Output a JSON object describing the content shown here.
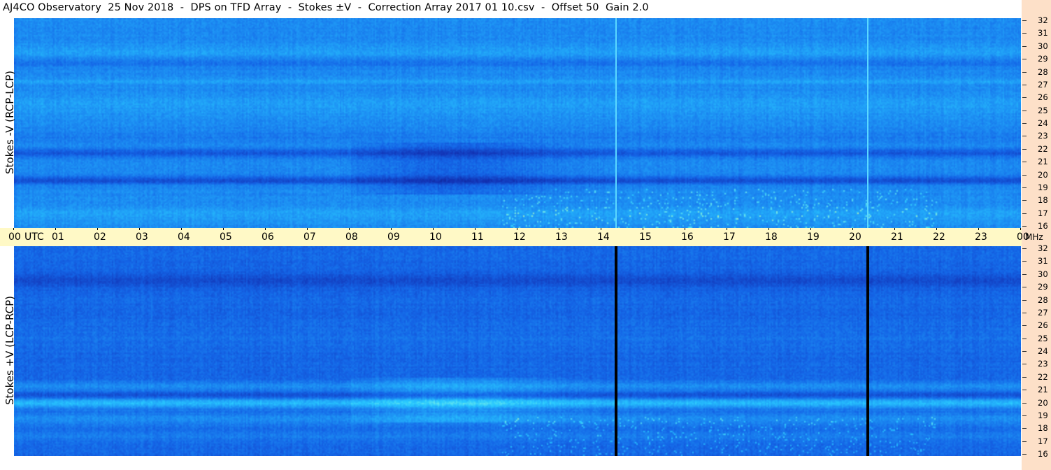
{
  "header": {
    "title": "AJ4CO Observatory  25 Nov 2018  -  DPS on TFD Array  -  Stokes ±V  -  Correction Array 2017 01 10.csv  -  Offset 50  Gain 2.0"
  },
  "chart_data": {
    "type": "heatmap",
    "title": "AJ4CO Observatory  25 Nov 2018  -  DPS on TFD Array  -  Stokes ±V  -  Correction Array 2017 01 10.csv  -  Offset 50  Gain 2.0",
    "x_axis": {
      "unit_label": "UTC",
      "range_hours": [
        0,
        24
      ],
      "tick_labels": [
        "00",
        "01",
        "02",
        "03",
        "04",
        "05",
        "06",
        "07",
        "08",
        "09",
        "10",
        "11",
        "12",
        "13",
        "14",
        "15",
        "16",
        "17",
        "18",
        "19",
        "20",
        "21",
        "22",
        "23",
        "00"
      ]
    },
    "y_axis": {
      "unit_label": "MHz",
      "range_mhz": [
        16,
        32
      ],
      "tick_labels": [
        "32",
        "31",
        "30",
        "29",
        "28",
        "27",
        "26",
        "25",
        "24",
        "23",
        "22",
        "21",
        "20",
        "19",
        "18",
        "17",
        "16"
      ]
    },
    "panels": [
      {
        "name": "top",
        "ylabel": "Stokes -V (RCP-LCP)",
        "palette": "cyan-blue",
        "marker_lines_utc": [
          14.35,
          20.35
        ],
        "marker_color": "#5ad8ff"
      },
      {
        "name": "bottom",
        "ylabel": "Stokes +V (LCP-RCP)",
        "palette": "blue-cyan",
        "marker_lines_utc": [
          14.35,
          20.35
        ],
        "marker_color": "#000000"
      }
    ],
    "colors": {
      "time_bar": "#fff9c6",
      "side_strip": "#fde0c8",
      "background_blue": "#1a6fe0",
      "bright": "#2bd8ff"
    }
  }
}
